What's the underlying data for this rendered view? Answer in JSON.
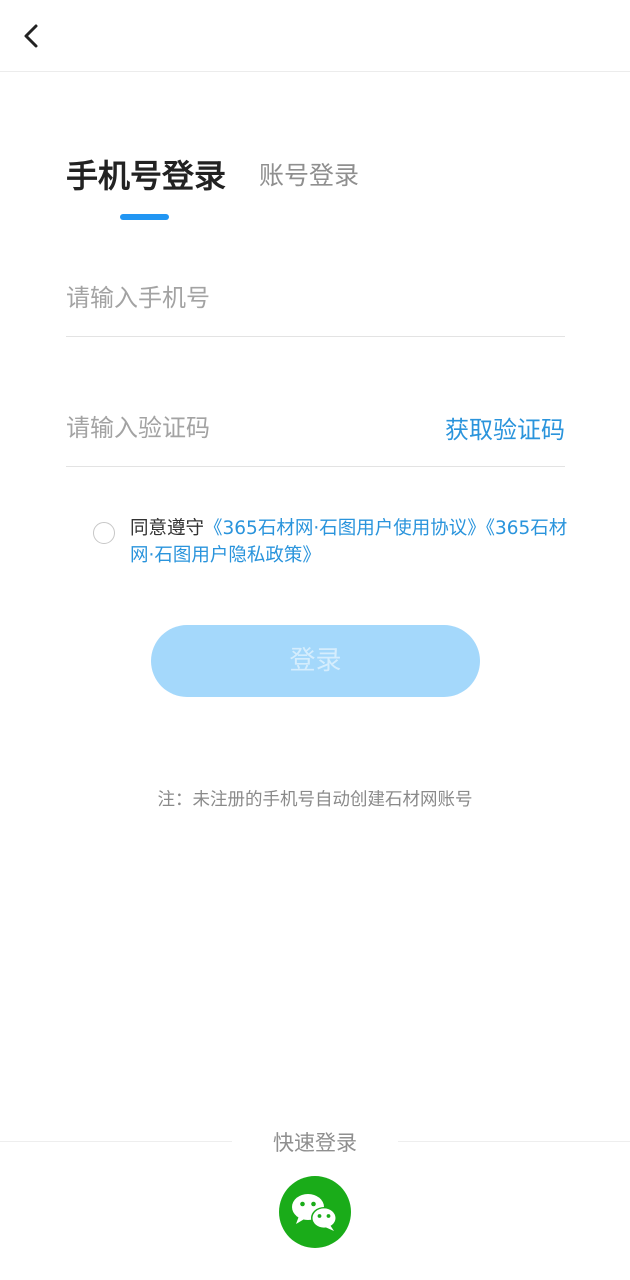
{
  "tabs": {
    "phone_login": "手机号登录",
    "account_login": "账号登录"
  },
  "form": {
    "phone_placeholder": "请输入手机号",
    "code_placeholder": "请输入验证码",
    "get_code_label": "获取验证码"
  },
  "agreement": {
    "prefix": "同意遵守",
    "user_agreement": "《365石材网·石图用户使用协议》",
    "privacy_policy": "《365石材网·石图用户隐私政策》",
    "checked": false
  },
  "login_button_label": "登录",
  "note": "注：未注册的手机号自动创建石材网账号",
  "quick_login": {
    "title": "快速登录",
    "wechat_icon": "wechat-icon"
  },
  "colors": {
    "accent": "#2a94dc",
    "indicator": "#2196f3",
    "login_button_disabled": "#a4d8fb",
    "wechat_green": "#1aac19"
  }
}
